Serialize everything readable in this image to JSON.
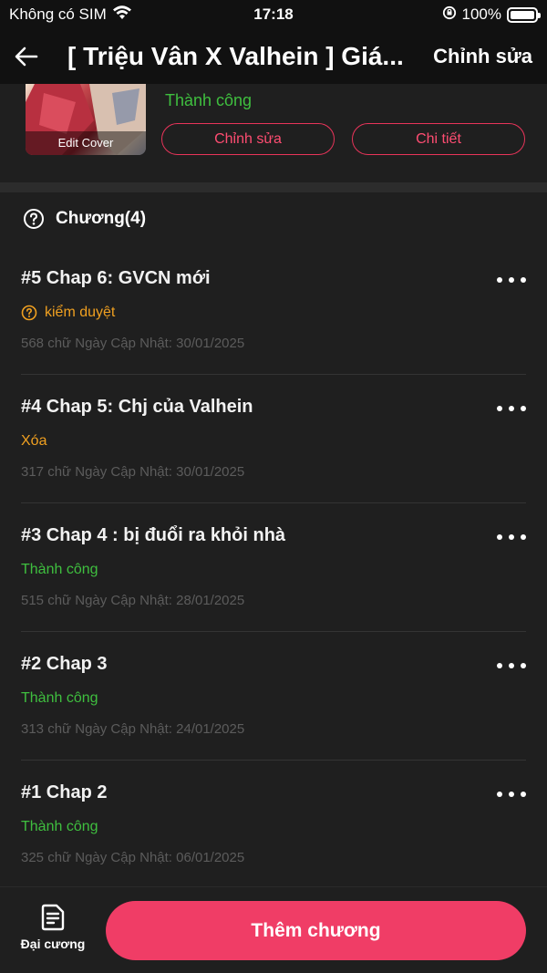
{
  "status_bar": {
    "carrier": "Không có SIM",
    "time": "17:18",
    "battery": "100%",
    "battery_level": 1.0
  },
  "nav": {
    "title": "[ Triệu Vân X Valhein ] Giá...",
    "action_label": "Chỉnh sửa"
  },
  "story": {
    "cover_label": "Edit Cover",
    "status": "Thành công",
    "edit_label": "Chỉnh sửa",
    "detail_label": "Chi tiết"
  },
  "chapters_section": {
    "title": "Chương(4)"
  },
  "chapters": [
    {
      "title": "#5 Chap 6: GVCN mới",
      "status": "kiểm duyệt",
      "status_color": "#f0a020",
      "status_icon": "question-icon",
      "meta": "568 chữ Ngày Cập Nhật: 30/01/2025"
    },
    {
      "title": "#4 Chap 5: Chj của Valhein",
      "status": "Xóa",
      "status_color": "#f0a020",
      "status_icon": "",
      "meta": "317 chữ Ngày Cập Nhật: 30/01/2025"
    },
    {
      "title": "#3 Chap 4 : bị đuổi ra khỏi nhà",
      "status": "Thành công",
      "status_color": "#3fbf3f",
      "status_icon": "",
      "meta": "515 chữ Ngày Cập Nhật: 28/01/2025"
    },
    {
      "title": "#2 Chap 3",
      "status": "Thành công",
      "status_color": "#3fbf3f",
      "status_icon": "",
      "meta": "313 chữ Ngày Cập Nhật: 24/01/2025"
    },
    {
      "title": "#1 Chap 2",
      "status": "Thành công",
      "status_color": "#3fbf3f",
      "status_icon": "",
      "meta": "325 chữ Ngày Cập Nhật: 06/01/2025"
    }
  ],
  "bottom": {
    "outline_label": "Đại cương",
    "add_chapter_label": "Thêm chương"
  },
  "colors": {
    "accent": "#f03d66",
    "success": "#3fbf3f",
    "warning": "#f0a020"
  }
}
